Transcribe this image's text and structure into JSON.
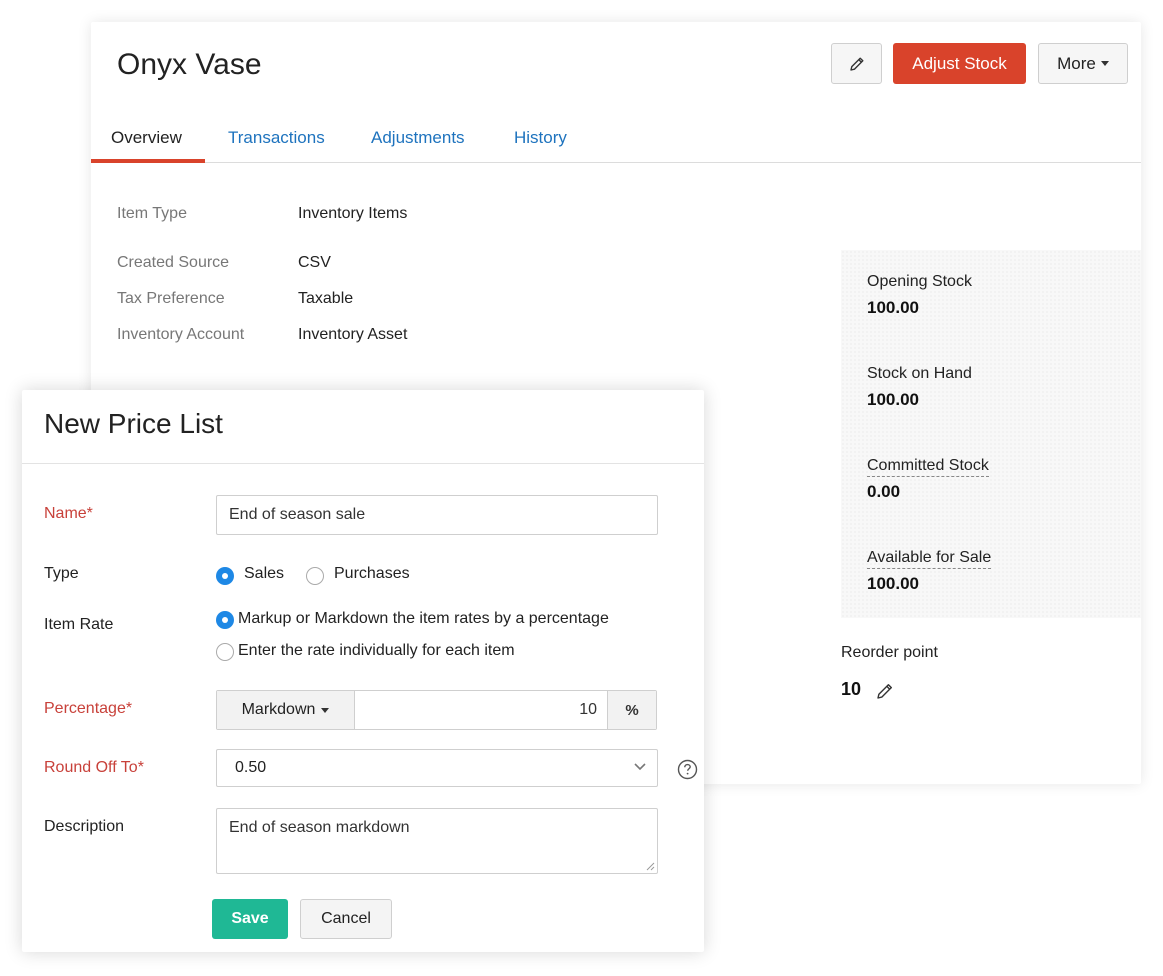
{
  "item": {
    "title": "Onyx Vase",
    "actions": {
      "edit_icon": "pencil-icon",
      "adjust_stock_label": "Adjust Stock",
      "more_label": "More"
    },
    "tabs": [
      {
        "label": "Overview",
        "active": true
      },
      {
        "label": "Transactions",
        "active": false
      },
      {
        "label": "Adjustments",
        "active": false
      },
      {
        "label": "History",
        "active": false
      }
    ],
    "details": [
      {
        "label": "Item Type",
        "value": "Inventory Items"
      },
      {
        "label": "Created Source",
        "value": "CSV"
      },
      {
        "label": "Tax Preference",
        "value": "Taxable"
      },
      {
        "label": "Inventory Account",
        "value": "Inventory Asset"
      }
    ],
    "stock": [
      {
        "label": "Opening Stock",
        "value": "100.00"
      },
      {
        "label": "Stock on Hand",
        "value": "100.00"
      },
      {
        "label": "Committed Stock",
        "value": "0.00"
      },
      {
        "label": "Available for Sale",
        "value": "100.00"
      }
    ],
    "reorder": {
      "label": "Reorder point",
      "value": "10"
    }
  },
  "price_list_modal": {
    "title": "New Price List",
    "name": {
      "label": "Name*",
      "value": "End of season sale"
    },
    "type": {
      "label": "Type",
      "options": [
        "Sales",
        "Purchases"
      ],
      "selected": "Sales"
    },
    "item_rate": {
      "label": "Item Rate",
      "options": [
        "Markup or Markdown the item rates by a percentage",
        "Enter the rate individually for each item"
      ],
      "selected": "Markup or Markdown the item rates by a percentage"
    },
    "percentage": {
      "label": "Percentage*",
      "mode": "Markdown",
      "value": "10",
      "unit": "%"
    },
    "round_off": {
      "label": "Round Off To*",
      "value": "0.50"
    },
    "description": {
      "label": "Description",
      "value": "End of season markdown"
    },
    "buttons": {
      "save": "Save",
      "cancel": "Cancel"
    }
  },
  "colors": {
    "accent_red": "#d9432b",
    "link_blue": "#1e73be",
    "save_green": "#1fb895",
    "required_red": "#c8413a",
    "radio_blue": "#1e88e5"
  }
}
